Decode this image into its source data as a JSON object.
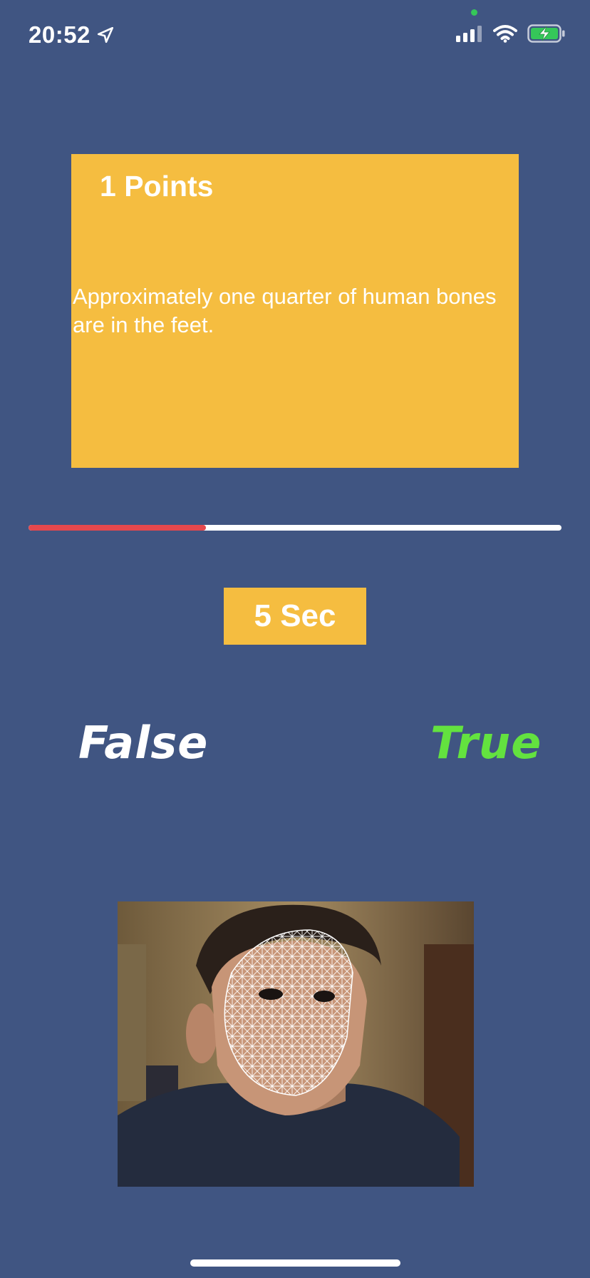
{
  "status_bar": {
    "time": "20:52",
    "battery_state": "charging",
    "indicator_color": "#35c759"
  },
  "card": {
    "points": "1 Points",
    "question": "Approximately one quarter of human bones are in the feet.",
    "color": "#f5bd40"
  },
  "progress": {
    "fraction": 0.333,
    "fill_color": "#e5484d",
    "track_color": "#ffffff"
  },
  "timer": {
    "label": "5 Sec"
  },
  "answers": {
    "false_label": "False",
    "true_label": "True",
    "true_color": "#63e23f",
    "false_color": "#ffffff"
  },
  "camera": {
    "icon": "face-mesh-camera-preview"
  }
}
